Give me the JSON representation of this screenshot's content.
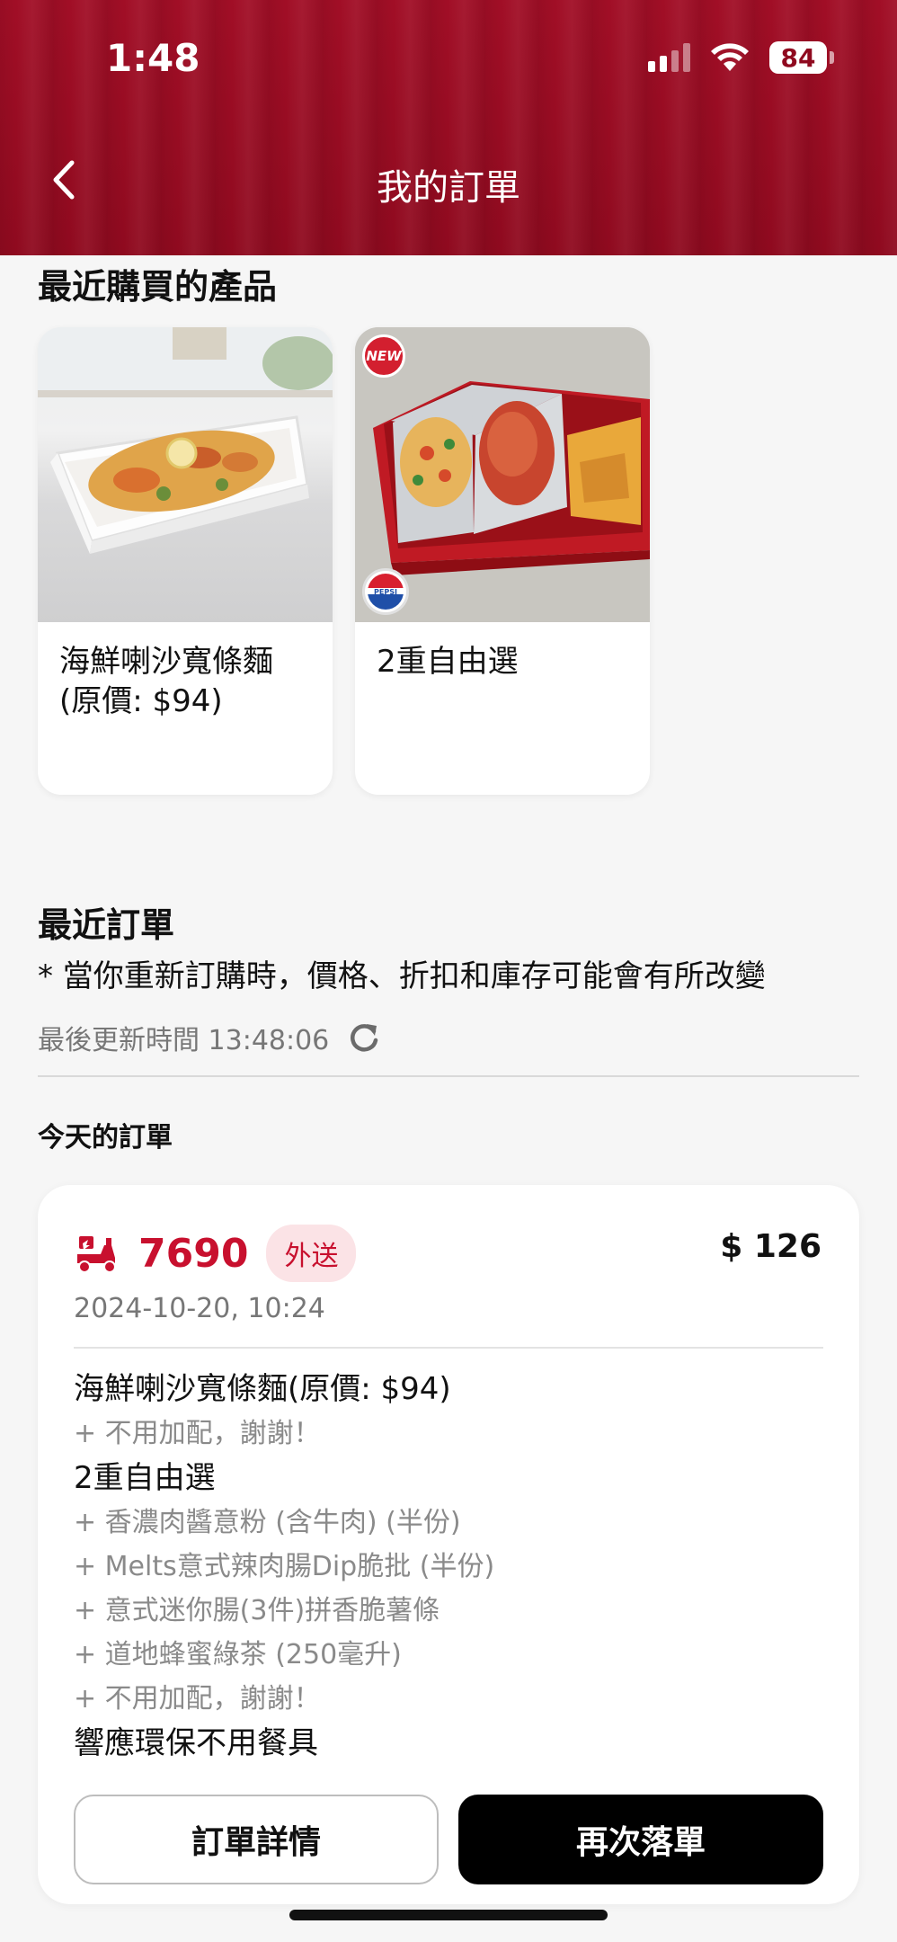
{
  "status_bar": {
    "time": "1:48",
    "battery": "84",
    "icons": [
      "signal-icon",
      "wifi-icon",
      "battery-icon"
    ]
  },
  "header": {
    "title": "我的訂單",
    "back_icon": "chevron-left-icon"
  },
  "recent_products": {
    "title": "最近購買的產品",
    "items": [
      {
        "name": "海鮮喇沙寬條麵(原價: $94)",
        "image": "seafood-laksa-noodle-dish"
      },
      {
        "name": "2重自由選",
        "image": "combo-box-meal",
        "badge": "NEW",
        "drink_badge": "PEPSI"
      }
    ]
  },
  "recent_orders": {
    "title": "最近訂單",
    "note": "* 當你重新訂購時，價格、折扣和庫存可能會有所改變",
    "last_updated": "最後更新時間 13:48:06",
    "refresh_icon": "refresh-icon",
    "today_label": "今天的訂單",
    "order": {
      "number": "7690",
      "type": "外送",
      "total": "$ 126",
      "date": "2024-10-20, 10:24",
      "delivery_icon": "delivery-scooter-icon",
      "lines": [
        {
          "kind": "main",
          "text": "海鮮喇沙寬條麵(原價: $94)"
        },
        {
          "kind": "sub",
          "text": "+ 不用加配，謝謝！"
        },
        {
          "kind": "main",
          "text": "2重自由選"
        },
        {
          "kind": "sub",
          "text": "+ 香濃肉醬意粉 (含牛肉) (半份)"
        },
        {
          "kind": "sub",
          "text": "+ Melts意式辣肉腸Dip脆批 (半份)"
        },
        {
          "kind": "sub",
          "text": "+ 意式迷你腸(3件)拼香脆薯條"
        },
        {
          "kind": "sub",
          "text": "+ 道地蜂蜜綠茶 (250毫升)"
        },
        {
          "kind": "sub",
          "text": "+ 不用加配，謝謝！"
        },
        {
          "kind": "main",
          "text": "響應環保不用餐具"
        }
      ],
      "detail_button": "訂單詳情",
      "reorder_button": "再次落單"
    }
  },
  "colors": {
    "brand_red": "#c8102e",
    "header_red": "#9b0d24",
    "tag_bg": "#fbe3e6"
  }
}
